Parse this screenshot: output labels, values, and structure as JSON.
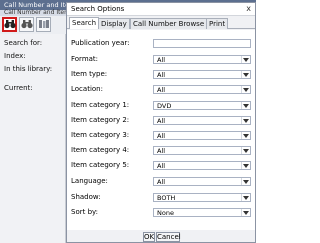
{
  "background_window": {
    "title": "Call Number and Item Maintenance",
    "tab_label": "Call Number and Item",
    "labels": {
      "search_for": "Search for:",
      "index": "Index:",
      "in_library": "In this library:",
      "current": "Current:"
    },
    "toolbar_icons": [
      "binoculars-icon",
      "binoculars-icon",
      "books-icon"
    ]
  },
  "dialog": {
    "title": "Search Options",
    "close_label": "x",
    "tabs": [
      {
        "label": "Search",
        "active": true
      },
      {
        "label": "Display",
        "active": false
      },
      {
        "label": "Call Number Browse",
        "active": false
      },
      {
        "label": "Print",
        "active": false
      }
    ],
    "fields": [
      {
        "label": "Publication year:",
        "type": "text",
        "value": ""
      },
      {
        "label": "Format:",
        "type": "select",
        "value": "All"
      },
      {
        "label": "Item type:",
        "type": "select",
        "value": "All"
      },
      {
        "label": "Location:",
        "type": "select",
        "value": "All"
      },
      {
        "label": "Item category 1:",
        "type": "select",
        "value": "DVD"
      },
      {
        "label": "Item category 2:",
        "type": "select",
        "value": "All"
      },
      {
        "label": "Item category 3:",
        "type": "select",
        "value": "All"
      },
      {
        "label": "Item category 4:",
        "type": "select",
        "value": "All"
      },
      {
        "label": "Item category 5:",
        "type": "select",
        "value": "All"
      },
      {
        "label": "Language:",
        "type": "select",
        "value": "All"
      },
      {
        "label": "Shadow:",
        "type": "select",
        "value": "BOTH"
      },
      {
        "label": "Sort by:",
        "type": "select",
        "value": "None"
      }
    ],
    "buttons": {
      "ok": "OK",
      "cancel": "Cancel"
    }
  }
}
